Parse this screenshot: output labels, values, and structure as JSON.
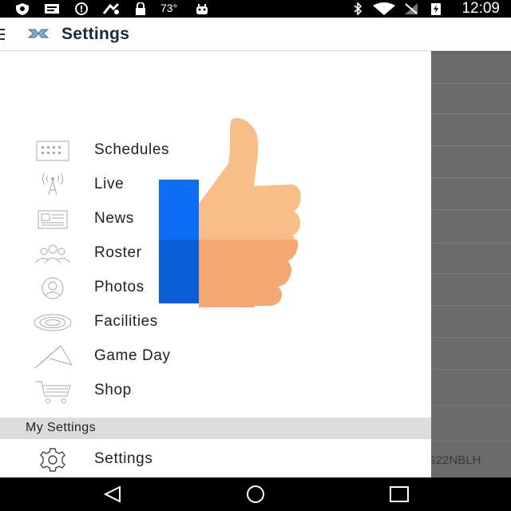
{
  "status_bar": {
    "temperature": "73°",
    "time": "12:09",
    "icons": [
      "shield-icon",
      "message-icon",
      "alert-circle-icon",
      "fitness-icon",
      "lock-icon",
      "android-icon",
      "bluetooth-icon",
      "wifi-icon",
      "no-signal-icon",
      "battery-charging-icon"
    ]
  },
  "app_bar": {
    "title": "Settings",
    "logo": "unc-logo-icon",
    "menu_icon": "hamburger-icon"
  },
  "drawer": {
    "items": [
      {
        "label": "Schedules",
        "icon": "calendar-icon"
      },
      {
        "label": "Live",
        "icon": "antenna-icon"
      },
      {
        "label": "News",
        "icon": "newspaper-icon"
      },
      {
        "label": "Roster",
        "icon": "people-icon"
      },
      {
        "label": "Photos",
        "icon": "user-circle-icon"
      },
      {
        "label": "Facilities",
        "icon": "stadium-icon"
      },
      {
        "label": "Game Day",
        "icon": "pennant-icon"
      },
      {
        "label": "Shop",
        "icon": "cart-icon"
      }
    ],
    "section_header": "My Settings",
    "settings_item": {
      "label": "Settings",
      "icon": "gear-icon"
    }
  },
  "underlay": {
    "code_text": "G22NBLH"
  },
  "overlay": {
    "icon": "thumbs-up-icon"
  },
  "nav_bar": {
    "buttons": [
      "back-icon",
      "home-icon",
      "recents-icon"
    ]
  }
}
